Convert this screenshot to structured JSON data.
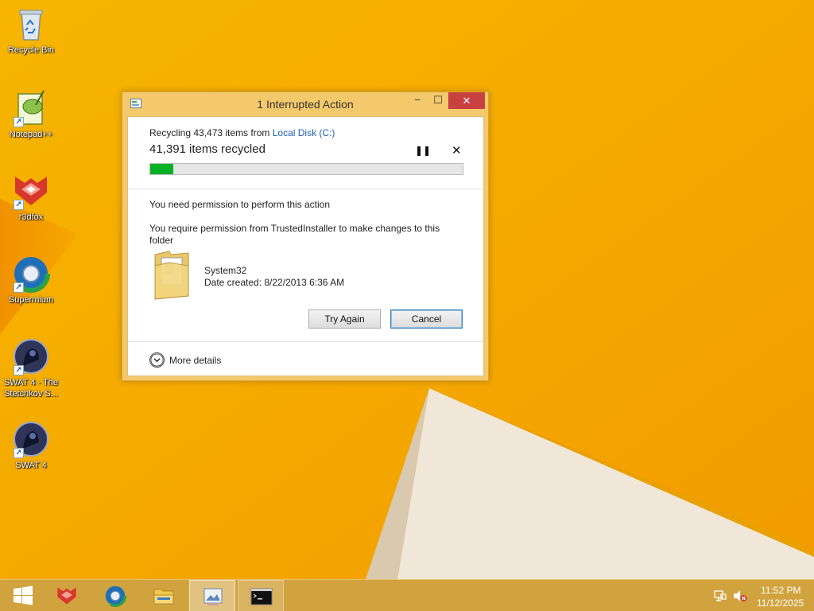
{
  "desktop": {
    "icons": [
      {
        "label": "Recycle Bin",
        "icon": "recycle-bin-icon"
      },
      {
        "label": "Notepad++",
        "icon": "notepad-plus-plus-icon"
      },
      {
        "label": "r3dfox",
        "icon": "r3dfox-icon"
      },
      {
        "label": "Supermium",
        "icon": "supermium-icon"
      },
      {
        "label": "SWAT 4 - The Stetchkov S...",
        "icon": "swat4-expansion-icon"
      },
      {
        "label": "SWAT 4",
        "icon": "swat4-icon"
      }
    ]
  },
  "dialog": {
    "title": "1 Interrupted Action",
    "controls": {
      "minimize": "−",
      "maximize": "☐",
      "close": "✕"
    },
    "operation": {
      "prefix": "Recycling 43,473 items from ",
      "source": "Local Disk (C:)",
      "items_done": "41,391 items recycled",
      "progress_fraction": 0.075,
      "pause_glyph": "❚❚",
      "stop_glyph": "✕"
    },
    "permission": {
      "heading": "You need permission to perform this action",
      "detail": "You require permission from TrustedInstaller to make changes to this folder",
      "folder_name": "System32",
      "date_created": "Date created: 8/22/2013 6:36 AM"
    },
    "buttons": {
      "try_again": "Try Again",
      "cancel": "Cancel"
    },
    "more_details": "More details"
  },
  "taskbar": {
    "items": [
      "start-icon",
      "r3dfox-icon",
      "supermium-icon",
      "file-explorer-icon",
      "photos-icon",
      "command-prompt-icon"
    ],
    "tray_icons": [
      "network-icon",
      "volume-muted-icon"
    ],
    "time": "11:52 PM",
    "date": "11/12/2025"
  },
  "colors": {
    "wallpaper": "#f5a800",
    "accent_green": "#06b025",
    "link_blue": "#1a5fb4"
  }
}
